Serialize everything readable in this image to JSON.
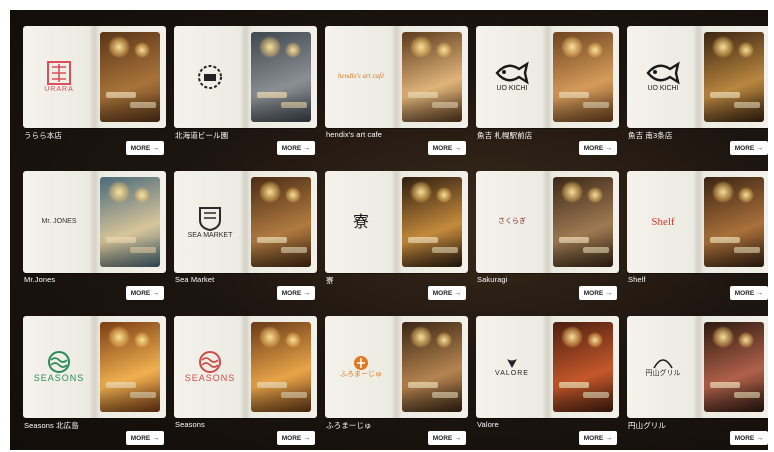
{
  "more_label": "MORE",
  "more_arrow": "→",
  "cards": [
    {
      "name": "うらら本店",
      "logo_text": "URARA",
      "logo_color": "#d9505a",
      "photo": [
        "#5a3518",
        "#a8733a"
      ]
    },
    {
      "name": "北海道ビール園",
      "logo_text": "",
      "logo_color": "#222222",
      "photo": [
        "#3e4650",
        "#8a8f92"
      ]
    },
    {
      "name": "hendix's art cafe",
      "logo_text": "hendix's art café",
      "logo_color": "#d8782a",
      "photo": [
        "#5b3a1e",
        "#e0b47a"
      ]
    },
    {
      "name": "魚吉 札幌駅前店",
      "logo_text": "UO KICHI",
      "logo_color": "#1a1a1a",
      "photo": [
        "#6d4320",
        "#d59b5a"
      ]
    },
    {
      "name": "魚吉 南3条店",
      "logo_text": "UO KICHI",
      "logo_color": "#1a1a1a",
      "photo": [
        "#3a2412",
        "#b9873f"
      ]
    },
    {
      "name": "Mr.Jones",
      "logo_text": "Mr. JONES",
      "logo_color": "#333333",
      "photo": [
        "#4a6a7a",
        "#d8c59a"
      ]
    },
    {
      "name": "Sea Market",
      "logo_text": "SEA MARKET",
      "logo_color": "#2a2a2a",
      "photo": [
        "#4a2c15",
        "#b07a40"
      ]
    },
    {
      "name": "寮",
      "logo_text": "寮",
      "logo_color": "#1a1a1a",
      "photo": [
        "#2e1d10",
        "#c48a3c"
      ]
    },
    {
      "name": "Sakuragi",
      "logo_text": "さくらぎ",
      "logo_color": "#7a1f2a",
      "photo": [
        "#3c2817",
        "#9e7a52"
      ]
    },
    {
      "name": "Shelf",
      "logo_text": "Shelf",
      "logo_color": "#c83a2a",
      "photo": [
        "#3b2414",
        "#a9703a"
      ]
    },
    {
      "name": "Seasons 北広島",
      "logo_text": "SEASONS",
      "logo_color": "#2b8a5a",
      "photo": [
        "#7a3d14",
        "#f0b050"
      ]
    },
    {
      "name": "Seasons",
      "logo_text": "SEASONS",
      "logo_color": "#d04a4a",
      "photo": [
        "#6a3a18",
        "#e8a448"
      ]
    },
    {
      "name": "ふろまーじゅ",
      "logo_text": "ふろまーじゅ",
      "logo_color": "#e07a20",
      "photo": [
        "#3a2614",
        "#b58450"
      ]
    },
    {
      "name": "Valore",
      "logo_text": "VALORE",
      "logo_color": "#222222",
      "photo": [
        "#4a1f10",
        "#c4572a"
      ]
    },
    {
      "name": "円山グリル",
      "logo_text": "円山グリル",
      "logo_color": "#222222",
      "photo": [
        "#2c1a10",
        "#b0604a"
      ]
    }
  ]
}
